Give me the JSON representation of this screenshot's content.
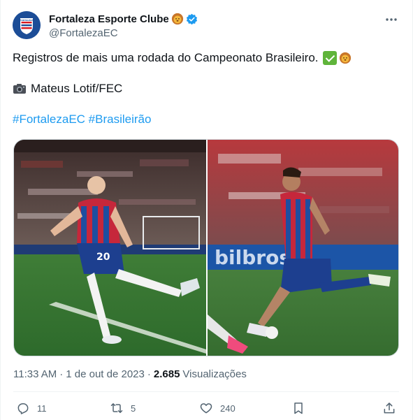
{
  "account": {
    "display_name": "Fortaleza Esporte Clube",
    "handle": "@FortalezaEC",
    "verified": true,
    "avatar_text": "FORTALEZA"
  },
  "tweet": {
    "line1": "Registros de mais uma rodada do Campeonato Brasileiro.",
    "line2": "Mateus Lotif/FEC",
    "hashtags": [
      "#FortalezaEC",
      "#Brasileirão"
    ],
    "photos": [
      {
        "jersey_number": "20"
      },
      {
        "ad_text": "bilbros"
      }
    ]
  },
  "meta": {
    "time": "11:33 AM",
    "separator": "·",
    "date": "1 de out de 2023",
    "views_count": "2.685",
    "views_label": "Visualizações"
  },
  "actions": {
    "reply_count": "11",
    "retweet_count": "5",
    "like_count": "240"
  },
  "colors": {
    "text": "#0f1419",
    "secondary": "#536471",
    "link": "#1d9bf0",
    "verified": "#1d9bf0",
    "divider": "#eff3f4"
  },
  "icons": [
    "more-icon",
    "verified-icon",
    "lion-emoji",
    "check-emoji",
    "camera-emoji",
    "reply-icon",
    "retweet-icon",
    "like-icon",
    "bookmark-icon",
    "share-icon"
  ]
}
